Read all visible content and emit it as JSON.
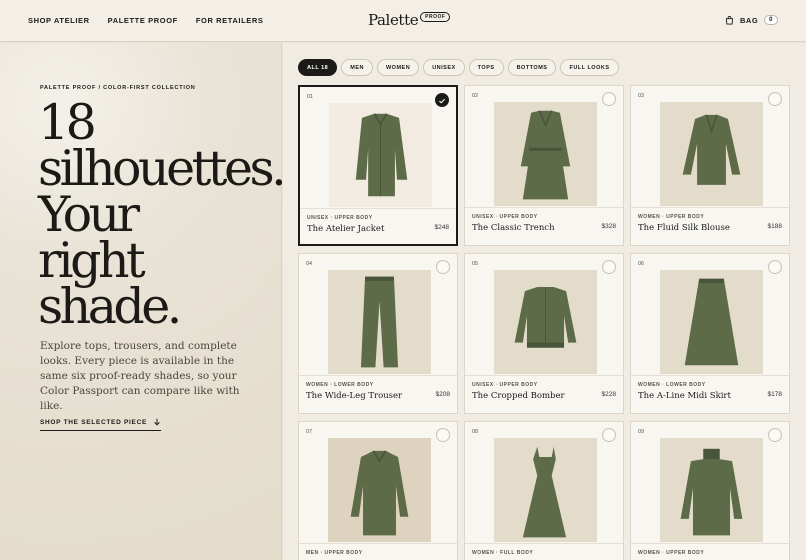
{
  "nav": {
    "links": [
      "SHOP ATELIER",
      "PALETTE PROOF",
      "FOR RETAILERS"
    ],
    "logo": "Palette",
    "logo_badge": "PROOF",
    "bag_label": "BAG",
    "bag_count": "0"
  },
  "hero": {
    "eyebrow": "PALETTE PROOF / COLOR-FIRST COLLECTION",
    "headline": [
      "18",
      "silhouettes.",
      "Your",
      "right",
      "shade."
    ],
    "description": "Explore tops, trousers, and complete looks. Every piece is available in the same six proof-ready shades, so your Color Passport can compare like with like.",
    "cta": "SHOP THE SELECTED PIECE"
  },
  "filters": [
    "ALL 18",
    "MEN",
    "WOMEN",
    "UNISEX",
    "TOPS",
    "BOTTOMS",
    "FULL LOOKS"
  ],
  "products": [
    {
      "num": "01",
      "meta": "UNISEX · UPPER BODY",
      "name": "The Atelier Jacket",
      "price": "$248",
      "icon": "jacket-icon"
    },
    {
      "num": "02",
      "meta": "UNISEX · UPPER BODY",
      "name": "The Classic Trench",
      "price": "$328",
      "icon": "trench-icon"
    },
    {
      "num": "03",
      "meta": "WOMEN · UPPER BODY",
      "name": "The Fluid Silk Blouse",
      "price": "$188",
      "icon": "blouse-icon"
    },
    {
      "num": "04",
      "meta": "WOMEN · LOWER BODY",
      "name": "The Wide-Leg Trouser",
      "price": "$208",
      "icon": "trouser-icon"
    },
    {
      "num": "05",
      "meta": "UNISEX · UPPER BODY",
      "name": "The Cropped Bomber",
      "price": "$228",
      "icon": "bomber-icon"
    },
    {
      "num": "06",
      "meta": "WOMEN · LOWER BODY",
      "name": "The A-Line Midi Skirt",
      "price": "$178",
      "icon": "skirt-icon"
    },
    {
      "num": "07",
      "meta": "MEN · UPPER BODY",
      "name": "",
      "price": "",
      "icon": "shirt-icon"
    },
    {
      "num": "08",
      "meta": "WOMEN · FULL BODY",
      "name": "",
      "price": "",
      "icon": "dress-icon"
    },
    {
      "num": "09",
      "meta": "WOMEN · UPPER BODY",
      "name": "",
      "price": "",
      "icon": "sweater-icon"
    }
  ],
  "colors": {
    "garment": "#5d6b48",
    "garment_dark": "#48553a",
    "accent": "#1b1a17"
  }
}
